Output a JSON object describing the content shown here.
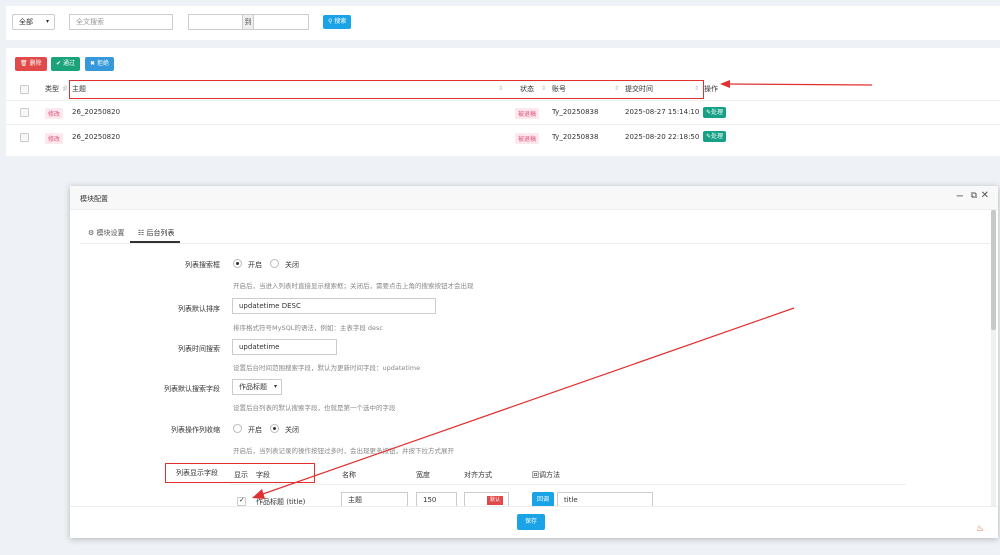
{
  "search": {
    "type_select": "全部",
    "fulltext_placeholder": "全文搜索",
    "range_sep": "到",
    "search_button": "搜索"
  },
  "toolbar": {
    "delete_label": "删除",
    "approve_label": "通过",
    "reject_label": "拒绝"
  },
  "table": {
    "headers": {
      "type": "类型",
      "subject": "主题",
      "status": "状态",
      "account": "账号",
      "submit_time": "提交时间",
      "actions": "操作"
    },
    "rows": [
      {
        "type": "修改",
        "subject": "26_20250820",
        "status": "被退稿",
        "account": "Ty_20250838",
        "time": "2025-08-27 15:14:10",
        "action": "处理"
      },
      {
        "type": "修改",
        "subject": "26_20250820",
        "status": "被退稿",
        "account": "Ty_20250838",
        "time": "2025-08-20 22:18:50",
        "action": "处理"
      }
    ]
  },
  "modal": {
    "title": "模块配置",
    "tabs": [
      "模块设置",
      "后台列表"
    ],
    "list_search_box": {
      "label": "列表搜索框",
      "on": "开启",
      "off": "关闭",
      "help": "开启后，当进入列表时直接显示搜索框；关闭后，需要点击上角的搜索按钮才会出现"
    },
    "default_sort": {
      "label": "列表默认排序",
      "value": "updatetime DESC",
      "help": "排序格式符号MySQL的语法，例如：主表字段 desc"
    },
    "time_search": {
      "label": "列表时间搜索",
      "value": "updatetime",
      "help": "设置后台时间范围搜索字段，默认为更新时间字段：updatetime"
    },
    "default_search_field": {
      "label": "列表默认搜索字段",
      "value": "作品标题",
      "help": "设置后台列表的默认搜索字段，也就是第一个选中的字段"
    },
    "action_collapse": {
      "label": "列表操作列收缩",
      "on": "开启",
      "off": "关闭",
      "help": "开启后，当列表记录的操作按钮过多时，会出现更多按钮，并按下拉方式展开"
    },
    "display_fields": {
      "label": "列表显示字段",
      "columns": [
        "显示",
        "字段",
        "名称",
        "宽度",
        "对齐方式",
        "回调方法"
      ],
      "row": {
        "field": "作品标题 (title)",
        "name": "主题",
        "width": "150",
        "align_tag": "默认",
        "callback_button": "回调",
        "callback_value": "title"
      }
    },
    "save_label": "保存"
  },
  "colors": {
    "accent": "#1aa3e6",
    "danger": "#e04a4a",
    "success": "#1aa37a",
    "highlight_box": "#e03030"
  }
}
